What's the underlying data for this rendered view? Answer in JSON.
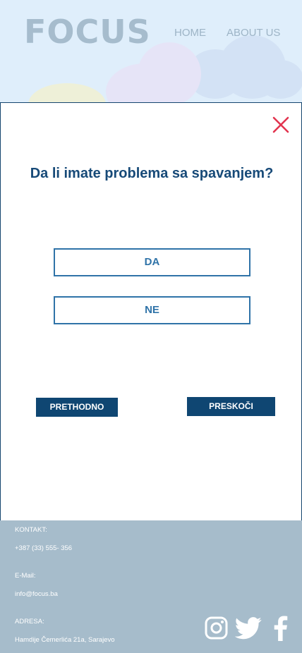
{
  "header": {
    "logo": "FOCUS",
    "nav": {
      "home": "HOME",
      "about": "ABOUT US"
    }
  },
  "modal": {
    "question": "Da li imate problema sa spavanjem?",
    "answers": {
      "yes": "DA",
      "no": "NE"
    },
    "prev_label": "PRETHODNO",
    "skip_label": "PRESKOČI"
  },
  "footer": {
    "contact_label": "KONTAKT:",
    "phone": "+387 (33) 555- 356",
    "email_label": "E-Mail:",
    "email": "info@focus.ba",
    "address_label": "ADRESA:",
    "address": "Hamdije Čemerlića 21a, Sarajevo"
  },
  "colors": {
    "accent_dark": "#0f4672",
    "accent": "#2f73a8",
    "close": "#e2344f",
    "footer_bg": "#a6bccb",
    "header_bg": "#dfeefb"
  },
  "icons": [
    "close-icon",
    "instagram-icon",
    "twitter-icon",
    "facebook-icon"
  ]
}
